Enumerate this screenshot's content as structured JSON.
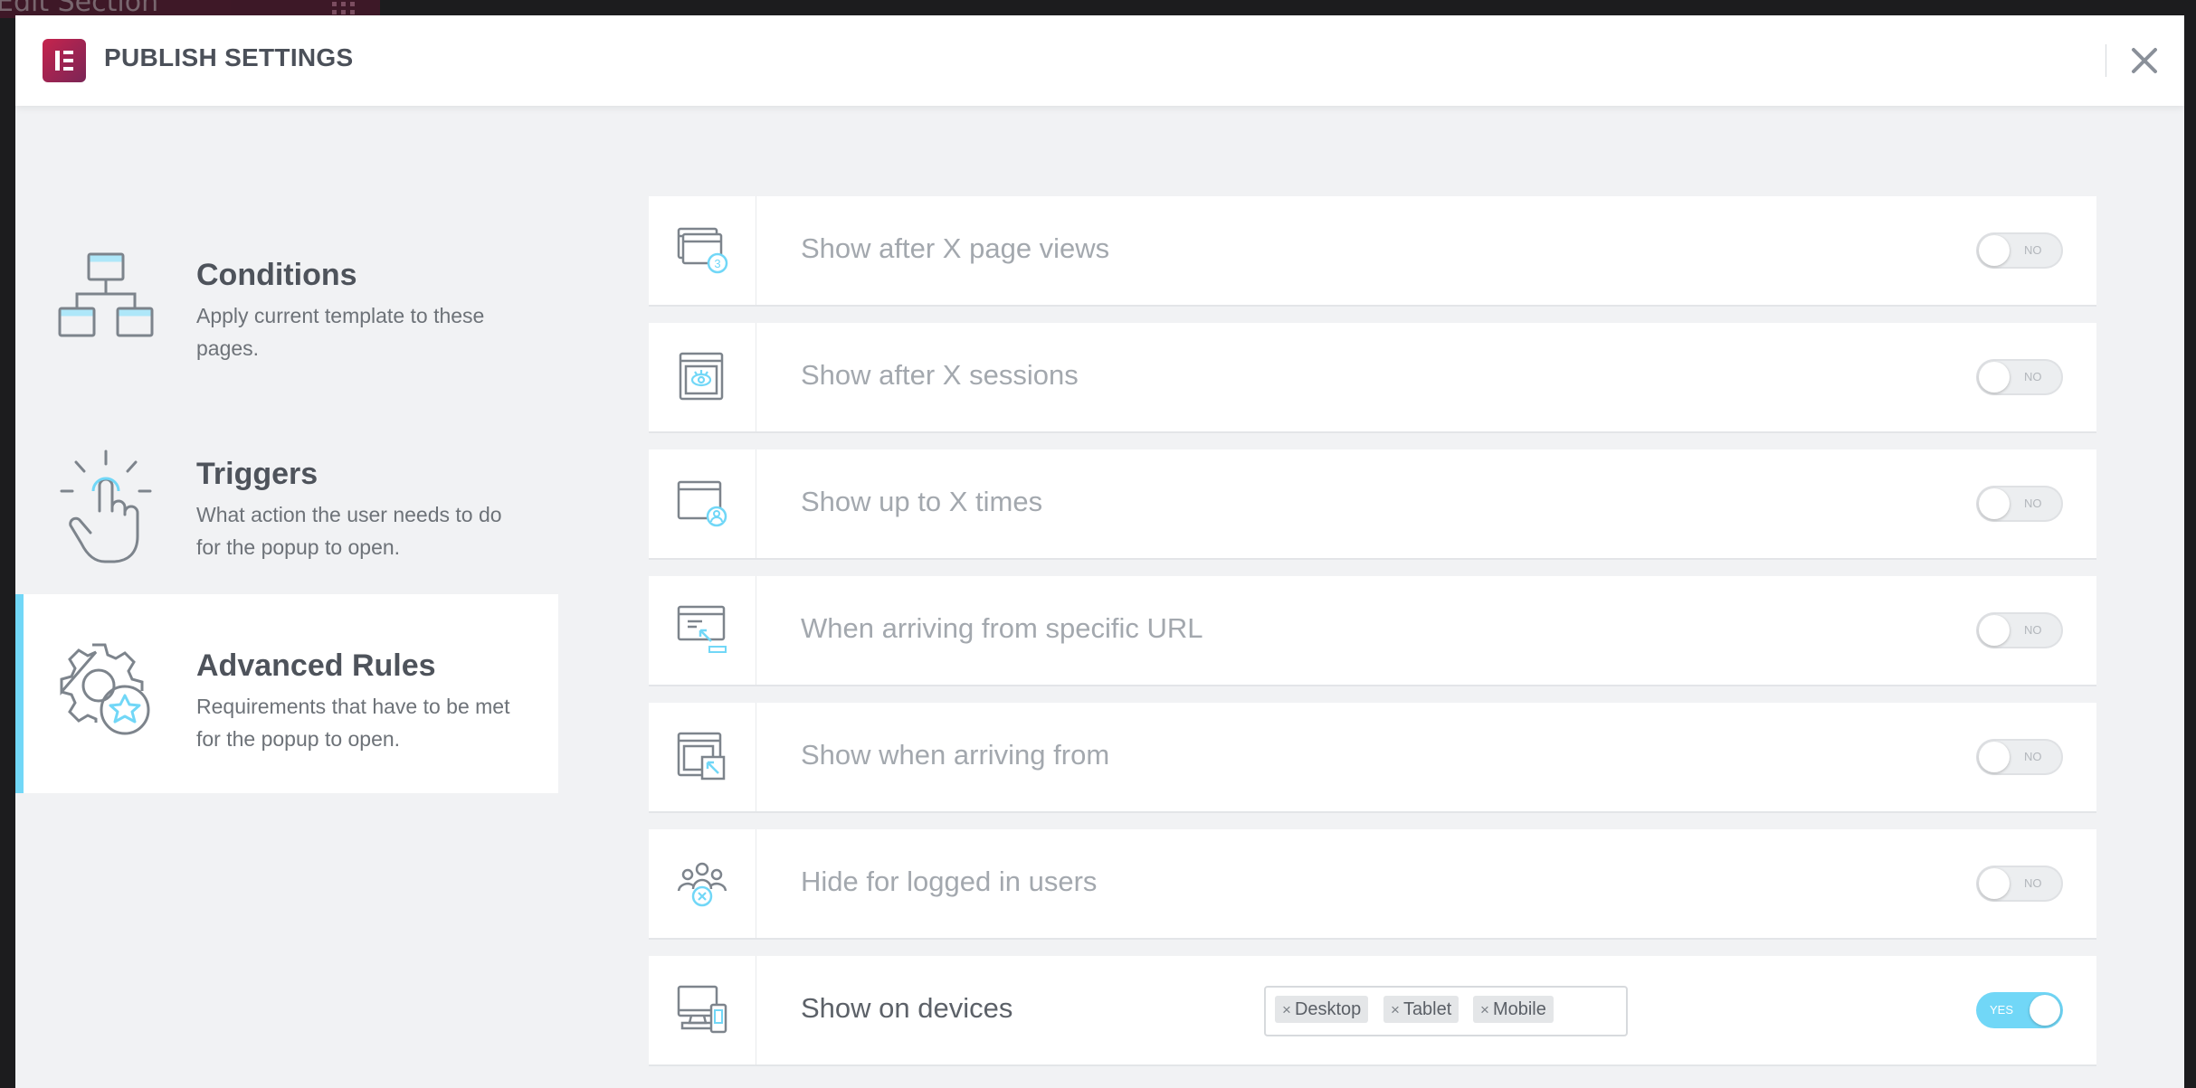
{
  "background": {
    "editor_label": "Edit Section"
  },
  "header": {
    "title": "PUBLISH SETTINGS"
  },
  "sidebar": {
    "items": [
      {
        "title": "Conditions",
        "desc": "Apply current template to these pages.",
        "icon": "sitemap-icon"
      },
      {
        "title": "Triggers",
        "desc": "What action the user needs to do for the popup to open.",
        "icon": "hand-tap-icon"
      },
      {
        "title": "Advanced Rules",
        "desc": "Requirements that have to be met for the popup to open.",
        "icon": "gear-star-icon",
        "active": true
      }
    ]
  },
  "rules": [
    {
      "label": "Show after X page views",
      "toggle": "NO",
      "on": false
    },
    {
      "label": "Show after X sessions",
      "toggle": "NO",
      "on": false
    },
    {
      "label": "Show up to X times",
      "toggle": "NO",
      "on": false
    },
    {
      "label": "When arriving from specific URL",
      "toggle": "NO",
      "on": false
    },
    {
      "label": "Show when arriving from",
      "toggle": "NO",
      "on": false
    },
    {
      "label": "Hide for logged in users",
      "toggle": "NO",
      "on": false
    },
    {
      "label": "Show on devices",
      "toggle": "YES",
      "on": true,
      "devices": [
        "Desktop",
        "Tablet",
        "Mobile"
      ]
    }
  ],
  "colors": {
    "accent": "#71d7f7",
    "brand": "#c6244d",
    "text": "#4e535b",
    "muted": "#a3a8ae"
  }
}
